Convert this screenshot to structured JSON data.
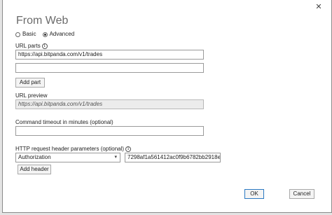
{
  "dialog": {
    "title": "From Web",
    "close_glyph": "✕"
  },
  "mode": {
    "basic_label": "Basic",
    "advanced_label": "Advanced",
    "selected": "Advanced"
  },
  "url_parts": {
    "label": "URL parts",
    "info_glyph": "i",
    "part1_value": "https://api.bitpanda.com/v1/trades",
    "part2_value": "",
    "add_part_label": "Add part"
  },
  "url_preview": {
    "label": "URL preview",
    "value": "https://api.bitpanda.com/v1/trades"
  },
  "timeout": {
    "label": "Command timeout in minutes (optional)",
    "value": ""
  },
  "headers": {
    "label": "HTTP request header parameters (optional)",
    "info_glyph": "i",
    "name_selected": "Authorization",
    "value": "7298af1a561412ac0f9b6782bb2918ec",
    "add_header_label": "Add header"
  },
  "footer": {
    "ok_label": "OK",
    "cancel_label": "Cancel"
  }
}
